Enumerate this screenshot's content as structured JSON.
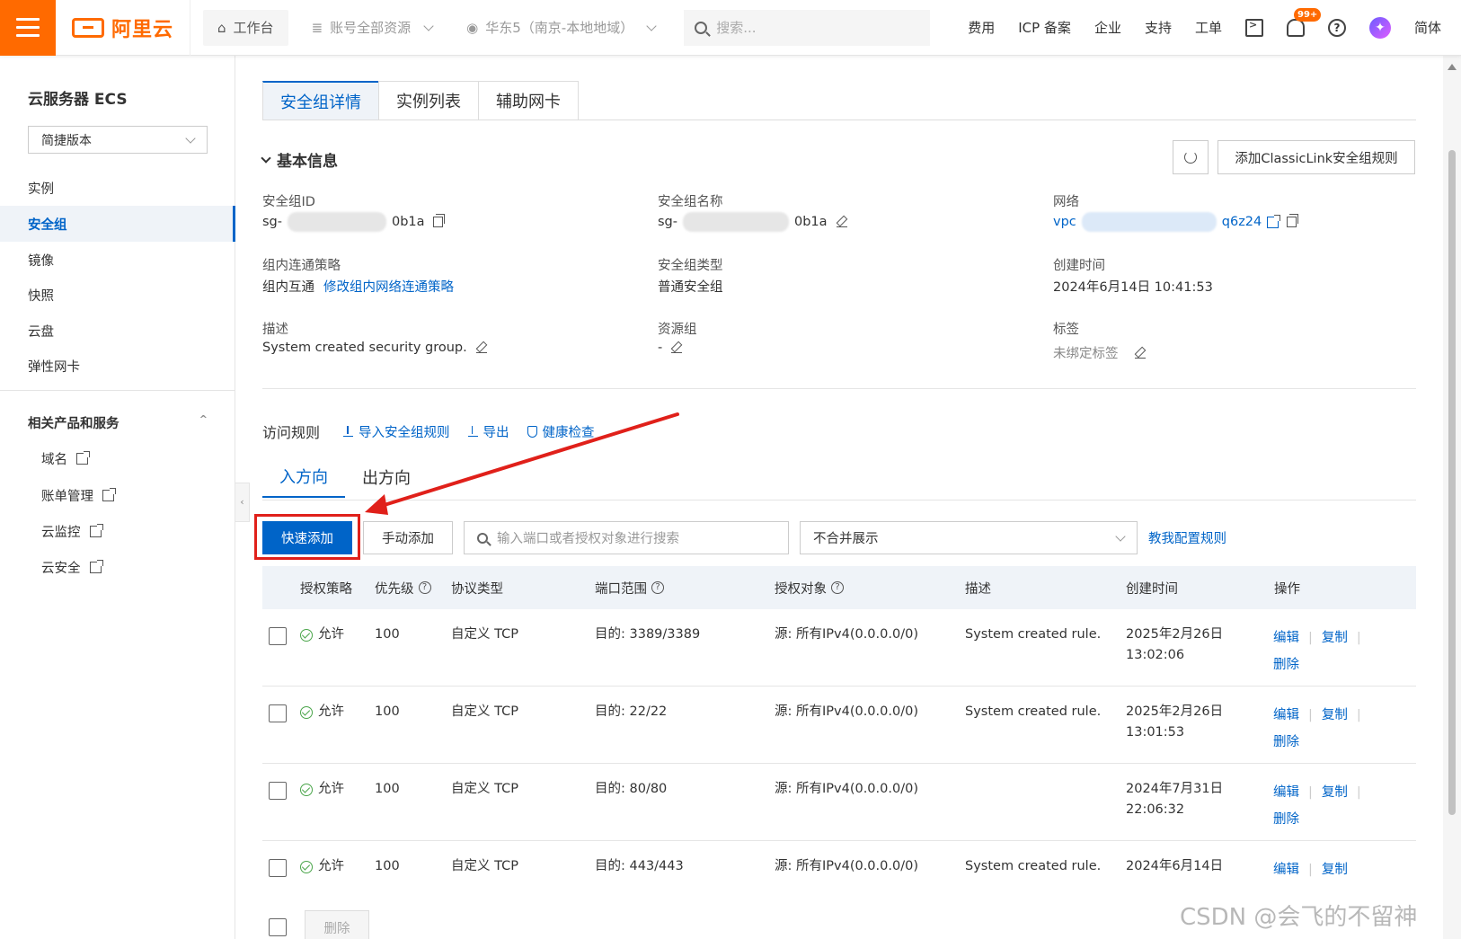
{
  "topbar": {
    "logo": "阿里云",
    "workbench": "工作台",
    "resources": "账号全部资源",
    "region": "华东5（南京-本地地域）",
    "search_placeholder": "搜索...",
    "links": [
      "费用",
      "ICP 备案",
      "企业",
      "支持",
      "工单"
    ],
    "bell_badge": "99+",
    "lang": "简体"
  },
  "sidebar": {
    "title": "云服务器 ECS",
    "version_select": "简捷版本",
    "items": [
      "实例",
      "安全组",
      "镜像",
      "快照",
      "云盘",
      "弹性网卡"
    ],
    "active_item": "安全组",
    "section_title": "相关产品和服务",
    "sub_items": [
      "域名",
      "账单管理",
      "云监控",
      "云安全"
    ]
  },
  "tabs": [
    "安全组详情",
    "实例列表",
    "辅助网卡"
  ],
  "basic_info": {
    "title": "基本信息",
    "classic_button": "添加ClassicLink安全组规则",
    "fields": {
      "sg_id_label": "安全组ID",
      "sg_id_prefix": "sg-",
      "sg_id_suffix": "0b1a",
      "sg_name_label": "安全组名称",
      "sg_name_prefix": "sg-",
      "sg_name_suffix": "0b1a",
      "network_label": "网络",
      "network_prefix": "vpc",
      "network_suffix": "q6z24",
      "policy_label": "组内连通策略",
      "policy_value": "组内互通",
      "policy_link": "修改组内网络连通策略",
      "type_label": "安全组类型",
      "type_value": "普通安全组",
      "created_label": "创建时间",
      "created_value": "2024年6月14日 10:41:53",
      "desc_label": "描述",
      "desc_value": "System created security group.",
      "rg_label": "资源组",
      "rg_value": "-",
      "tags_label": "标签",
      "tags_value": "未绑定标签"
    }
  },
  "rules": {
    "title": "访问规则",
    "import": "导入安全组规则",
    "export": "导出",
    "health": "健康检查",
    "dir_tabs": [
      "入方向",
      "出方向"
    ],
    "quick_add": "快速添加",
    "manual_add": "手动添加",
    "search_placeholder": "输入端口或者授权对象进行搜索",
    "merge_select": "不合并展示",
    "help_link": "教我配置规则",
    "columns": [
      "授权策略",
      "优先级",
      "协议类型",
      "端口范围",
      "授权对象",
      "描述",
      "创建时间",
      "操作"
    ],
    "rows": [
      {
        "policy": "允许",
        "priority": "100",
        "protocol": "自定义 TCP",
        "port": "目的: 3389/3389",
        "source": "源: 所有IPv4(0.0.0.0/0)",
        "desc": "System created rule.",
        "date": "2025年2月26日",
        "time": "13:02:06"
      },
      {
        "policy": "允许",
        "priority": "100",
        "protocol": "自定义 TCP",
        "port": "目的: 22/22",
        "source": "源: 所有IPv4(0.0.0.0/0)",
        "desc": "System created rule.",
        "date": "2025年2月26日",
        "time": "13:01:53"
      },
      {
        "policy": "允许",
        "priority": "100",
        "protocol": "自定义 TCP",
        "port": "目的: 80/80",
        "source": "源: 所有IPv4(0.0.0.0/0)",
        "desc": "",
        "date": "2024年7月31日",
        "time": "22:06:32"
      },
      {
        "policy": "允许",
        "priority": "100",
        "protocol": "自定义 TCP",
        "port": "目的: 443/443",
        "source": "源: 所有IPv4(0.0.0.0/0)",
        "desc": "System created rule.",
        "date": "2024年6月14日",
        "time": ""
      }
    ],
    "ops": {
      "edit": "编辑",
      "copy": "复制",
      "delete": "删除"
    },
    "footer_delete": "删除"
  },
  "watermark": "CSDN @会飞的不留神",
  "colors": {
    "brand": "#ff6a00",
    "primary": "#0064c8",
    "annotation": "#e0201a"
  }
}
